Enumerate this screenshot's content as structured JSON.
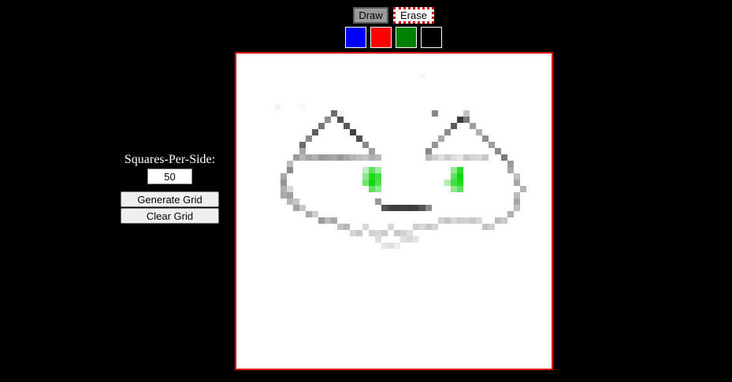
{
  "modes": {
    "draw_label": "Draw",
    "erase_label": "Erase"
  },
  "palette": {
    "colors": [
      "#0000ff",
      "#ff0000",
      "#008000",
      "#000000"
    ]
  },
  "controls": {
    "squares_label": "Squares-Per-Side:",
    "squares_value": "50",
    "generate_label": "Generate Grid",
    "clear_label": "Clear Grid"
  },
  "grid": {
    "size": 50,
    "background": "#ffffff",
    "cells": [
      [
        16,
        9,
        "#f2f2f2"
      ],
      [
        10,
        8,
        "#f7f7f7"
      ],
      [
        29,
        3,
        "#f8f8f8"
      ],
      [
        6,
        8,
        "#f4f4f4"
      ],
      [
        15,
        9,
        "#6e6e6e"
      ],
      [
        16,
        10,
        "#505050"
      ],
      [
        17,
        11,
        "#5a5a5a"
      ],
      [
        18,
        12,
        "#444444"
      ],
      [
        19,
        13,
        "#505050"
      ],
      [
        20,
        14,
        "#888888"
      ],
      [
        21,
        15,
        "#a0a0a0"
      ],
      [
        22,
        16,
        "#b8b8b8"
      ],
      [
        14,
        10,
        "#909090"
      ],
      [
        13,
        11,
        "#787878"
      ],
      [
        12,
        12,
        "#5e5e5e"
      ],
      [
        11,
        13,
        "#8a8a8a"
      ],
      [
        10,
        14,
        "#6a6a6a"
      ],
      [
        10,
        15,
        "#a8a8a8"
      ],
      [
        9,
        16,
        "#9a9a9a"
      ],
      [
        8,
        17,
        "#bdbdbd"
      ],
      [
        8,
        18,
        "#8a8a8a"
      ],
      [
        7,
        19,
        "#aaaaaa"
      ],
      [
        7,
        20,
        "#959595"
      ],
      [
        7,
        21,
        "#b0b0b0"
      ],
      [
        8,
        21,
        "#d8d8d8"
      ],
      [
        7,
        22,
        "#aaaaaa"
      ],
      [
        8,
        22,
        "#a0a0a0"
      ],
      [
        8,
        23,
        "#b8b8b8"
      ],
      [
        9,
        23,
        "#c5c5c5"
      ],
      [
        9,
        24,
        "#a2a2a2"
      ],
      [
        10,
        24,
        "#c8c8c8"
      ],
      [
        11,
        25,
        "#aaaaaa"
      ],
      [
        12,
        25,
        "#d0d0d0"
      ],
      [
        13,
        26,
        "#9a9a9a"
      ],
      [
        14,
        26,
        "#bbbbbb"
      ],
      [
        15,
        26,
        "#a8a8a8"
      ],
      [
        16,
        27,
        "#c2c2c2"
      ],
      [
        17,
        27,
        "#b5b5b5"
      ],
      [
        10,
        16,
        "#b8b8b8"
      ],
      [
        11,
        16,
        "#a5a5a5"
      ],
      [
        12,
        16,
        "#b0b0b0"
      ],
      [
        13,
        16,
        "#9a9a9a"
      ],
      [
        14,
        16,
        "#a0a0a0"
      ],
      [
        15,
        16,
        "#a8a8a8"
      ],
      [
        16,
        16,
        "#9a9a9a"
      ],
      [
        17,
        16,
        "#a6a6a6"
      ],
      [
        18,
        16,
        "#b5b5b5"
      ],
      [
        19,
        16,
        "#bebebe"
      ],
      [
        20,
        16,
        "#c5c5c5"
      ],
      [
        21,
        16,
        "#b0b0b0"
      ],
      [
        31,
        9,
        "#888888"
      ],
      [
        36,
        9,
        "#c5c5c5"
      ],
      [
        36,
        10,
        "#7a7a7a"
      ],
      [
        37,
        11,
        "#a0a0a0"
      ],
      [
        38,
        12,
        "#b2b2b2"
      ],
      [
        39,
        13,
        "#8e8e8e"
      ],
      [
        40,
        14,
        "#9e9e9e"
      ],
      [
        41,
        15,
        "#8a8a8a"
      ],
      [
        42,
        16,
        "#7a7a7a"
      ],
      [
        43,
        17,
        "#9c9c9c"
      ],
      [
        43,
        18,
        "#a8a8a8"
      ],
      [
        35,
        10,
        "#3a3a3a"
      ],
      [
        34,
        11,
        "#5c5c5c"
      ],
      [
        33,
        12,
        "#8a8a8a"
      ],
      [
        32,
        13,
        "#aaaaaa"
      ],
      [
        31,
        14,
        "#959595"
      ],
      [
        30,
        15,
        "#888888"
      ],
      [
        30,
        16,
        "#bbbbbb"
      ],
      [
        31,
        16,
        "#d0d0d0"
      ],
      [
        32,
        16,
        "#e0e0e0"
      ],
      [
        33,
        16,
        "#cccccc"
      ],
      [
        34,
        16,
        "#dddddd"
      ],
      [
        35,
        16,
        "#e6e6e6"
      ],
      [
        36,
        16,
        "#c8c8c8"
      ],
      [
        37,
        16,
        "#d4d4d4"
      ],
      [
        38,
        16,
        "#d8d8d8"
      ],
      [
        39,
        16,
        "#c6c6c6"
      ],
      [
        44,
        19,
        "#c0c0c0"
      ],
      [
        44,
        20,
        "#a8a8a8"
      ],
      [
        45,
        21,
        "#b5b5b5"
      ],
      [
        44,
        22,
        "#bcbcbc"
      ],
      [
        44,
        23,
        "#a6a6a6"
      ],
      [
        44,
        24,
        "#c0c0c0"
      ],
      [
        43,
        25,
        "#b0b0b0"
      ],
      [
        42,
        26,
        "#c8c8c8"
      ],
      [
        41,
        26,
        "#bdbdbd"
      ],
      [
        40,
        27,
        "#d0d0d0"
      ],
      [
        39,
        27,
        "#c2c2c2"
      ],
      [
        18,
        28,
        "#d4d4d4"
      ],
      [
        19,
        28,
        "#c8c8c8"
      ],
      [
        20,
        27,
        "#d8d8d8"
      ],
      [
        21,
        28,
        "#d0d0d0"
      ],
      [
        22,
        28,
        "#dadada"
      ],
      [
        23,
        28,
        "#cccccc"
      ],
      [
        24,
        27,
        "#d6d6d6"
      ],
      [
        25,
        28,
        "#c8c8c8"
      ],
      [
        26,
        28,
        "#d4d4d4"
      ],
      [
        27,
        28,
        "#e0e0e0"
      ],
      [
        28,
        27,
        "#cfcfcf"
      ],
      [
        29,
        27,
        "#d8d8d8"
      ],
      [
        30,
        27,
        "#c8c8c8"
      ],
      [
        31,
        27,
        "#d4d4d4"
      ],
      [
        32,
        26,
        "#d0d0d0"
      ],
      [
        33,
        26,
        "#c4c4c4"
      ],
      [
        34,
        26,
        "#d8d8d8"
      ],
      [
        35,
        26,
        "#cccccc"
      ],
      [
        36,
        26,
        "#d2d2d2"
      ],
      [
        37,
        26,
        "#c8c8c8"
      ],
      [
        38,
        26,
        "#d6d6d6"
      ],
      [
        22,
        29,
        "#dddddd"
      ],
      [
        26,
        29,
        "#e0e0e0"
      ],
      [
        27,
        29,
        "#d8d8d8"
      ],
      [
        28,
        29,
        "#e4e4e4"
      ],
      [
        23,
        30,
        "#e8e8e8"
      ],
      [
        24,
        30,
        "#e0e0e0"
      ],
      [
        25,
        30,
        "#eeeeee"
      ],
      [
        20,
        18,
        "#c0f0c0"
      ],
      [
        21,
        18,
        "#60e060"
      ],
      [
        22,
        18,
        "#a0eca0"
      ],
      [
        20,
        19,
        "#90e890"
      ],
      [
        21,
        19,
        "#20dc20"
      ],
      [
        22,
        19,
        "#40e040"
      ],
      [
        20,
        20,
        "#70e670"
      ],
      [
        21,
        20,
        "#10d810"
      ],
      [
        22,
        20,
        "#50e050"
      ],
      [
        21,
        21,
        "#60e060"
      ],
      [
        22,
        21,
        "#90e890"
      ],
      [
        34,
        18,
        "#90e890"
      ],
      [
        35,
        18,
        "#30dc30"
      ],
      [
        34,
        19,
        "#60e060"
      ],
      [
        35,
        19,
        "#10d810"
      ],
      [
        33,
        20,
        "#b0eeb0"
      ],
      [
        34,
        20,
        "#40e040"
      ],
      [
        35,
        20,
        "#20dc20"
      ],
      [
        34,
        21,
        "#90e890"
      ],
      [
        35,
        21,
        "#60e060"
      ],
      [
        23,
        24,
        "#555555"
      ],
      [
        24,
        24,
        "#404040"
      ],
      [
        25,
        24,
        "#3a3a3a"
      ],
      [
        26,
        24,
        "#404040"
      ],
      [
        27,
        24,
        "#3a3a3a"
      ],
      [
        28,
        24,
        "#404040"
      ],
      [
        29,
        24,
        "#555555"
      ],
      [
        30,
        24,
        "#888888"
      ],
      [
        22,
        23,
        "#999999"
      ]
    ]
  }
}
